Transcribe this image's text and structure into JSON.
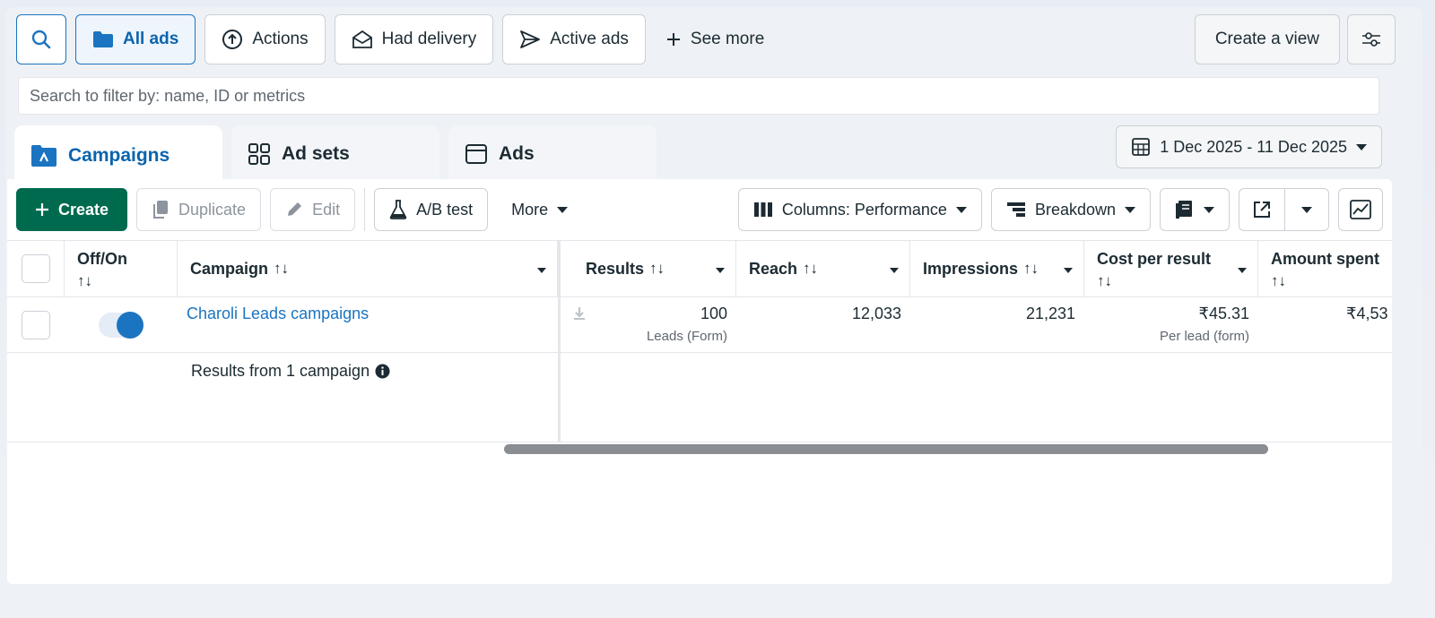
{
  "topbar": {
    "filters": [
      {
        "label": "All ads",
        "icon": "folder-icon",
        "active": true
      },
      {
        "label": "Actions",
        "icon": "arrow-up-circle-icon",
        "active": false
      },
      {
        "label": "Had delivery",
        "icon": "envelope-open-icon",
        "active": false
      },
      {
        "label": "Active ads",
        "icon": "send-icon",
        "active": false
      }
    ],
    "see_more": "See more",
    "create_view": "Create a view"
  },
  "search": {
    "placeholder": "Search to filter by: name, ID or metrics"
  },
  "tabs": [
    {
      "label": "Campaigns",
      "selected": true
    },
    {
      "label": "Ad sets",
      "selected": false
    },
    {
      "label": "Ads",
      "selected": false
    }
  ],
  "date_range": "1 Dec 2025 - 11 Dec 2025",
  "toolbar": {
    "create": "Create",
    "duplicate": "Duplicate",
    "edit": "Edit",
    "ab_test": "A/B test",
    "more": "More",
    "columns": "Columns: Performance",
    "breakdown": "Breakdown"
  },
  "table": {
    "headers": {
      "off_on": "Off/On",
      "campaign": "Campaign",
      "results": "Results",
      "reach": "Reach",
      "impressions": "Impressions",
      "cost_per_result": "Cost per result",
      "amount_spent": "Amount spent",
      "sort_glyph": "↑↓"
    },
    "row": {
      "campaign": "Charoli Leads campaigns",
      "results": "100",
      "results_sub": "Leads (Form)",
      "reach": "12,033",
      "impressions": "21,231",
      "cost_per_result": "₹45.31",
      "cost_sub": "Per lead (form)",
      "amount_spent": "₹4,53"
    },
    "summary": "Results from 1 campaign"
  },
  "colors": {
    "accent": "#1b74c0",
    "primary_button": "#006a4e"
  }
}
